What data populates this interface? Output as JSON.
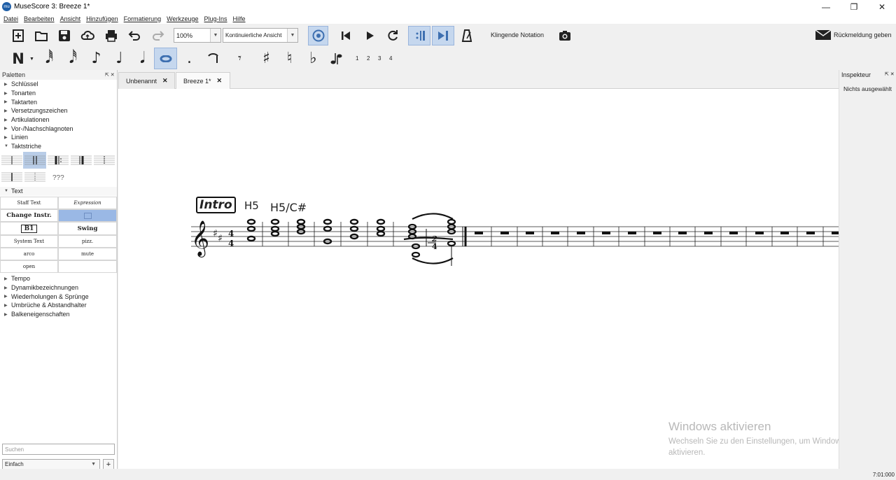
{
  "window": {
    "title": "MuseScore 3: Breeze 1*",
    "app_icon": "mu"
  },
  "menu": [
    "Datei",
    "Bearbeiten",
    "Ansicht",
    "Hinzufügen",
    "Formatierung",
    "Werkzeuge",
    "Plug-Ins",
    "Hilfe"
  ],
  "toolbar": {
    "zoom": "100%",
    "view_mode": "Kontinuierliche Ansicht",
    "concert_pitch": "Klingende Notation",
    "feedback": "Rückmeldung geben"
  },
  "note_input": {
    "voice_numbers": [
      "1",
      "2",
      "3",
      "4"
    ]
  },
  "palettes": {
    "title": "Paletten",
    "sections": [
      "Schlüssel",
      "Tonarten",
      "Taktarten",
      "Versetzungszeichen",
      "Artikulationen",
      "Vor-/Nachschlagnoten",
      "Linien",
      "Taktstriche"
    ],
    "barline_unknown": "???",
    "text_section": "Text",
    "text_cells": [
      [
        "Staff Text",
        "Expression"
      ],
      [
        "Change Instr.",
        ""
      ],
      [
        "B1",
        "Swing"
      ],
      [
        "System Text",
        "pizz."
      ],
      [
        "arco",
        "mute"
      ],
      [
        "open",
        ""
      ]
    ],
    "sections_after": [
      "Tempo",
      "Dynamikbezeichnungen",
      "Wiederholungen & Sprünge",
      "Umbrüche & Abstandhalter",
      "Balkeneigenschaften"
    ],
    "search_placeholder": "Suchen",
    "workspace": "Einfach"
  },
  "tabs": [
    {
      "label": "Unbenannt"
    },
    {
      "label": "Breeze 1*"
    }
  ],
  "score": {
    "rehearsal_mark": "Intro",
    "chord1": "H5",
    "chord2": "H5/C#"
  },
  "inspector": {
    "title": "Inspekteur",
    "status": "Nichts ausgewählt"
  },
  "watermark": {
    "title": "Windows aktivieren",
    "line": "Wechseln Sie zu den Einstellungen, um Windows zu aktivieren."
  },
  "status": {
    "time": "7:01:000"
  }
}
